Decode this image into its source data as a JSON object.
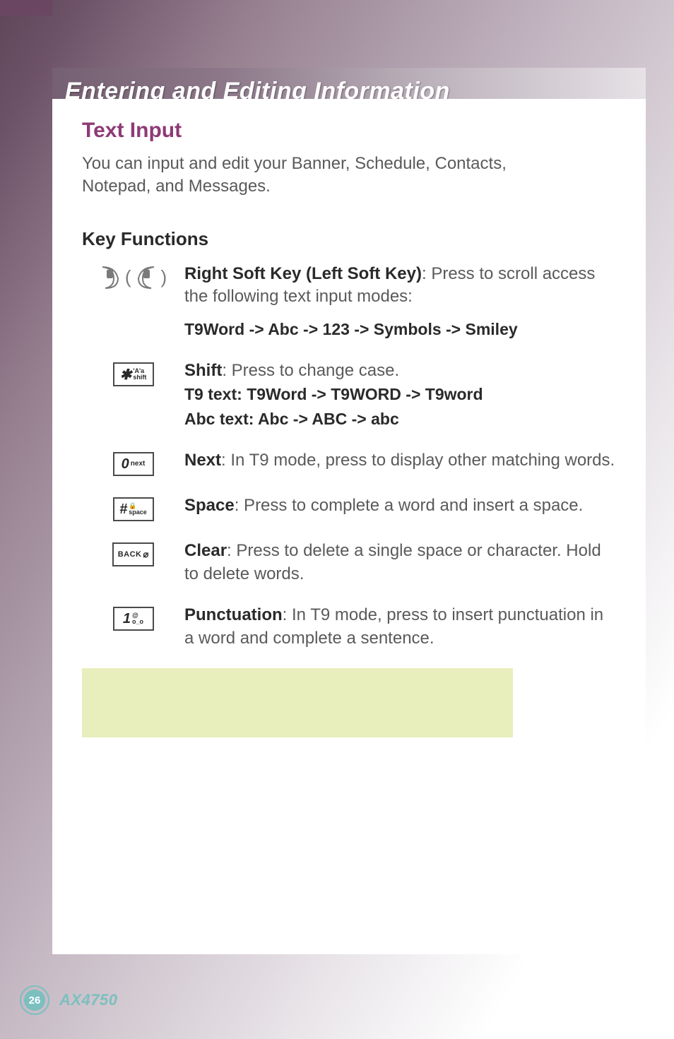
{
  "header": {
    "title": "Entering and Editing Information"
  },
  "section": {
    "title": "Text Input",
    "intro": "You can input and edit your Banner, Schedule, Contacts, Notepad, and Messages.",
    "subhead": "Key Functions"
  },
  "rows": {
    "softkey": {
      "label_bold": "Right Soft Key (Left Soft Key)",
      "label_rest": ": Press to scroll access the following text input modes:",
      "modes": "T9Word -> Abc -> 123 -> Symbols -> Smiley"
    },
    "shift": {
      "key_main": "✱",
      "key_sub_top": "'A'a",
      "key_sub_bot": "shift",
      "label_bold": "Shift",
      "label_rest": ": Press to change case.",
      "line2_prefix": "T9 text",
      "line2_rest": ": T9Word -> T9WORD -> T9word",
      "line3_prefix": "Abc text",
      "line3_rest": ": Abc -> ABC -> abc"
    },
    "next": {
      "key_main": "0",
      "key_sub": "next",
      "label_bold": "Next",
      "label_rest": ": In T9 mode, press to display other matching words."
    },
    "space": {
      "key_main": "#",
      "key_sub_top": "🔒",
      "key_sub_bot": "space",
      "label_bold": "Space",
      "label_rest": ": Press to complete a word and insert a space."
    },
    "clear": {
      "key_text": "BACK",
      "key_icon": "⌀",
      "label_bold": "Clear",
      "label_rest": ": Press to delete a single space or character. Hold to delete words."
    },
    "punct": {
      "key_main": "1",
      "key_sub_top": "@",
      "key_sub_bot": "o_o",
      "label_bold": "Punctuation",
      "label_rest": ": In T9 mode, press to insert punctuation in a word and complete a sentence."
    }
  },
  "footer": {
    "page": "26",
    "model": "AX4750"
  }
}
